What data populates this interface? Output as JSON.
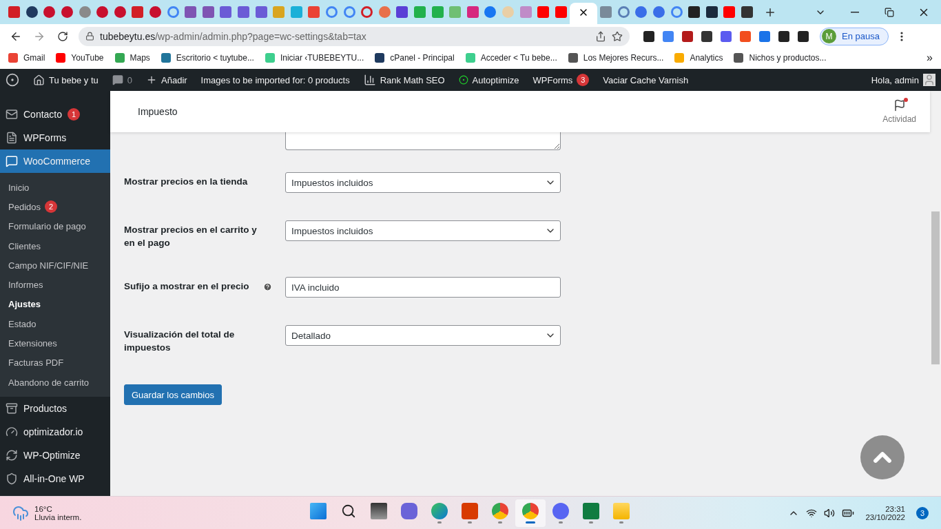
{
  "browser": {
    "tabs": [
      {
        "kind": "square",
        "color": "#d21f26",
        "selected": false
      },
      {
        "kind": "circle",
        "color": "#1f3a5f",
        "selected": false
      },
      {
        "kind": "circle",
        "color": "#c8102e",
        "selected": false
      },
      {
        "kind": "circle",
        "color": "#c8102e",
        "selected": false
      },
      {
        "kind": "circle",
        "color": "#8a8a8a",
        "selected": false
      },
      {
        "kind": "circle",
        "color": "#c8102e",
        "selected": false
      },
      {
        "kind": "circle",
        "color": "#c8102e",
        "selected": false
      },
      {
        "kind": "square",
        "color": "#d21f26",
        "selected": false
      },
      {
        "kind": "circle",
        "color": "#c8102e",
        "selected": false
      },
      {
        "kind": "ring",
        "color": "#4285f4",
        "selected": false
      },
      {
        "kind": "square",
        "color": "#7f54b3",
        "selected": false
      },
      {
        "kind": "square",
        "color": "#7f54b3",
        "selected": false
      },
      {
        "kind": "square",
        "color": "#6b5bd6",
        "selected": false
      },
      {
        "kind": "square",
        "color": "#6b5bd6",
        "selected": false
      },
      {
        "kind": "square",
        "color": "#6b5bd6",
        "selected": false
      },
      {
        "kind": "square",
        "color": "#d9a520",
        "selected": false
      },
      {
        "kind": "square",
        "color": "#1ab0d8",
        "selected": false
      },
      {
        "kind": "square",
        "color": "#ea4335",
        "selected": false
      },
      {
        "kind": "ring",
        "color": "#4285f4",
        "selected": false
      },
      {
        "kind": "ring",
        "color": "#4285f4",
        "selected": false
      },
      {
        "kind": "ring",
        "color": "#d21f26",
        "selected": false
      },
      {
        "kind": "circle",
        "color": "#e8704a",
        "selected": false
      },
      {
        "kind": "square",
        "color": "#5a3fd6",
        "selected": false
      },
      {
        "kind": "square",
        "color": "#22b14c",
        "selected": false
      },
      {
        "kind": "square",
        "color": "#22b14c",
        "selected": false
      },
      {
        "kind": "square",
        "color": "#6fbf73",
        "selected": false
      },
      {
        "kind": "square",
        "color": "#d6287f",
        "selected": false
      },
      {
        "kind": "circle",
        "color": "#1877f2",
        "selected": false
      },
      {
        "kind": "circle",
        "color": "#e9cfa6",
        "selected": false
      },
      {
        "kind": "square",
        "color": "#c08bc8",
        "selected": false
      },
      {
        "kind": "square",
        "color": "#ff0000",
        "selected": false
      },
      {
        "kind": "square",
        "color": "#ff0000",
        "selected": false
      },
      {
        "selected": true
      },
      {
        "kind": "square",
        "color": "#7a8a99",
        "selected": false
      },
      {
        "kind": "ring",
        "color": "#5b7fb5",
        "selected": false
      },
      {
        "kind": "circle",
        "color": "#3a6ee8",
        "selected": false
      },
      {
        "kind": "circle",
        "color": "#3a6ee8",
        "selected": false
      },
      {
        "kind": "ring",
        "color": "#4285f4",
        "selected": false
      },
      {
        "kind": "square",
        "color": "#222222",
        "selected": false
      },
      {
        "kind": "square",
        "color": "#1b2a3d",
        "selected": false
      },
      {
        "kind": "square",
        "color": "#ff0000",
        "selected": false
      },
      {
        "kind": "square",
        "color": "#333333",
        "selected": false
      }
    ],
    "url": {
      "host": "tubebeytu.es",
      "path": "/wp-admin/admin.php?page=wc-settings&tab=tax"
    },
    "extensions": [
      {
        "color": "#222222"
      },
      {
        "color": "#4285f4"
      },
      {
        "color": "#b31b1b"
      },
      {
        "color": "#333333"
      },
      {
        "color": "#5b5bf0"
      },
      {
        "color": "#f24e1e"
      },
      {
        "color": "#1a73e8"
      },
      {
        "color": "#222222"
      },
      {
        "color": "#222222"
      }
    ],
    "profile": {
      "initial": "M",
      "status": "En pausa"
    },
    "bookmarks": [
      {
        "label": "Gmail",
        "color": "#ea4335"
      },
      {
        "label": "YouTube",
        "color": "#ff0000"
      },
      {
        "label": "Maps",
        "color": "#34a853"
      },
      {
        "label": "Escritorio < tuytube...",
        "color": "#21759b"
      },
      {
        "label": "Iniciar ‹TUBEBEYTU...",
        "color": "#3ecf8e"
      },
      {
        "label": "cPanel - Principal",
        "color": "#1f3a5f"
      },
      {
        "label": "Acceder < Tu bebe...",
        "color": "#3ecf8e"
      },
      {
        "label": "Los Mejores Recurs...",
        "color": "#555555"
      },
      {
        "label": "Analytics",
        "color": "#f9ab00"
      },
      {
        "label": "Nichos y productos...",
        "color": "#555555"
      }
    ],
    "more_bookmarks": "»"
  },
  "admin_bar": {
    "site": "Tu bebe y tu",
    "comments": "0",
    "new": "Añadir",
    "images": "Images to be imported for: 0 products",
    "rank_math": "Rank Math SEO",
    "autoptimize": "Autoptimize",
    "wpforms": "WPForms",
    "wpforms_count": "3",
    "varnish": "Vaciar Cache Varnish",
    "greeting": "Hola, admin"
  },
  "sidebar": {
    "items": [
      {
        "label": "Contacto",
        "kind": "mail",
        "badge": "1",
        "selected": false
      },
      {
        "label": "WPForms",
        "kind": "form",
        "selected": false
      },
      {
        "label": "WooCommerce",
        "kind": "woo",
        "selected": true,
        "children": [
          {
            "label": "Inicio",
            "selected": false
          },
          {
            "label": "Pedidos",
            "badge": "2",
            "selected": false
          },
          {
            "label": "Formulario de pago",
            "selected": false
          },
          {
            "label": "Clientes",
            "selected": false
          },
          {
            "label": "Campo NIF/CIF/NIE",
            "selected": false
          },
          {
            "label": "Informes",
            "selected": false
          },
          {
            "label": "Ajustes",
            "selected": true
          },
          {
            "label": "Estado",
            "selected": false
          },
          {
            "label": "Extensiones",
            "selected": false
          },
          {
            "label": "Facturas PDF",
            "selected": false
          },
          {
            "label": "Abandono de carrito",
            "selected": false
          }
        ]
      },
      {
        "label": "Productos",
        "kind": "archive",
        "selected": false
      },
      {
        "label": "optimizador.io",
        "kind": "gauge",
        "selected": false
      },
      {
        "label": "WP-Optimize",
        "kind": "optimize",
        "selected": false
      },
      {
        "label": "All-in-One WP",
        "kind": "shield",
        "selected": false
      }
    ]
  },
  "header": {
    "title": "Impuesto",
    "activity": "Actividad"
  },
  "form": {
    "rows": [
      {
        "label": "Mostrar precios en la tienda",
        "help": false,
        "kind": "select",
        "value": "Impuestos incluidos"
      },
      {
        "label": "Mostrar precios en el carrito y en el pago",
        "help": false,
        "kind": "select",
        "value": "Impuestos incluidos"
      },
      {
        "label": "Sufijo a mostrar en el precio",
        "help": true,
        "kind": "text",
        "value": "IVA incluido"
      },
      {
        "label": "Visualización del total de impuestos",
        "help": false,
        "kind": "select",
        "value": "Detallado"
      }
    ],
    "save": "Guardar los cambios"
  },
  "taskbar": {
    "weather": {
      "temp": "16°C",
      "text": "Lluvia interm."
    },
    "apps": [
      {
        "kind": "start",
        "running": false,
        "selected": false
      },
      {
        "kind": "search",
        "running": false,
        "selected": false
      },
      {
        "kind": "taskview",
        "running": false,
        "selected": false
      },
      {
        "kind": "chat",
        "running": false,
        "selected": false
      },
      {
        "kind": "edge",
        "running": true,
        "selected": false
      },
      {
        "kind": "office",
        "running": true,
        "selected": false
      },
      {
        "kind": "chrome",
        "running": true,
        "selected": false
      },
      {
        "kind": "chrome",
        "running": true,
        "selected": true
      },
      {
        "kind": "discord",
        "running": true,
        "selected": false
      },
      {
        "kind": "excel",
        "running": true,
        "selected": false
      },
      {
        "kind": "folder",
        "running": true,
        "selected": false
      }
    ],
    "time": "23:31",
    "date": "23/10/2022",
    "notifications": "3"
  }
}
